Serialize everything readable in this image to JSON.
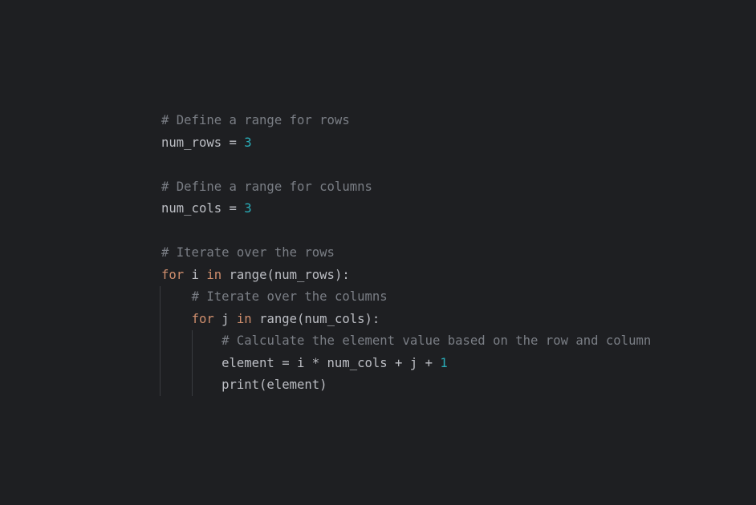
{
  "editor": {
    "theme_colors": {
      "background": "#1e1f22",
      "text": "#bcbec4",
      "comment": "#7a7e85",
      "keyword": "#cf8e6d",
      "number": "#2aacb8",
      "indent_guide": "#393b40"
    },
    "lines": [
      {
        "tokens": [
          {
            "type": "comment",
            "text": "# Define a range for rows"
          }
        ]
      },
      {
        "tokens": [
          {
            "type": "text",
            "text": "num_rows = "
          },
          {
            "type": "number",
            "text": "3"
          }
        ]
      },
      {
        "tokens": []
      },
      {
        "tokens": [
          {
            "type": "comment",
            "text": "# Define a range for columns"
          }
        ]
      },
      {
        "tokens": [
          {
            "type": "text",
            "text": "num_cols = "
          },
          {
            "type": "number",
            "text": "3"
          }
        ]
      },
      {
        "tokens": []
      },
      {
        "tokens": [
          {
            "type": "comment",
            "text": "# Iterate over the rows"
          }
        ]
      },
      {
        "tokens": [
          {
            "type": "keyword",
            "text": "for"
          },
          {
            "type": "text",
            "text": " i "
          },
          {
            "type": "keyword",
            "text": "in"
          },
          {
            "type": "text",
            "text": " range(num_rows):"
          }
        ]
      },
      {
        "tokens": [
          {
            "type": "text",
            "text": "    "
          },
          {
            "type": "comment",
            "text": "# Iterate over the columns"
          }
        ]
      },
      {
        "tokens": [
          {
            "type": "text",
            "text": "    "
          },
          {
            "type": "keyword",
            "text": "for"
          },
          {
            "type": "text",
            "text": " j "
          },
          {
            "type": "keyword",
            "text": "in"
          },
          {
            "type": "text",
            "text": " range(num_cols):"
          }
        ]
      },
      {
        "tokens": [
          {
            "type": "text",
            "text": "        "
          },
          {
            "type": "comment",
            "text": "# Calculate the element value based on the row and column"
          }
        ]
      },
      {
        "tokens": [
          {
            "type": "text",
            "text": "        element = i * num_cols + j + "
          },
          {
            "type": "number",
            "text": "1"
          }
        ]
      },
      {
        "tokens": [
          {
            "type": "text",
            "text": "        print(element)"
          }
        ]
      }
    ]
  }
}
